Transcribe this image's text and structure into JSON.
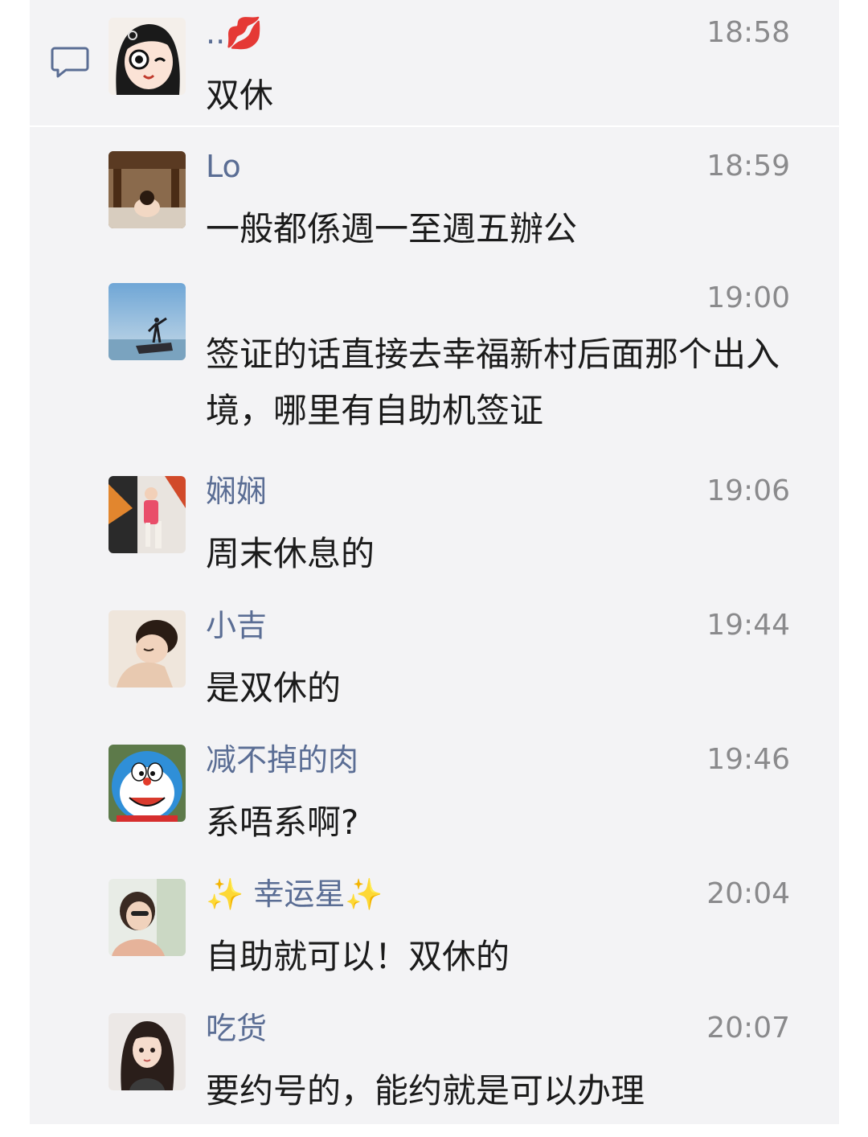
{
  "messages": [
    {
      "name": "..💋",
      "time": "18:58",
      "text": "双休",
      "avatar": "cartoon-girl-avatar"
    },
    {
      "name": "Lo",
      "time": "18:59",
      "text": "一般都係週一至週五辦公",
      "avatar": "toddler-under-table-avatar"
    },
    {
      "name": "",
      "time": "19:00",
      "text": "签证的话直接去幸福新村后面那个出入境，哪里有自助机签证",
      "avatar": "silhouette-on-rock-avatar"
    },
    {
      "name": "娴娴",
      "time": "19:06",
      "text": "周末休息的",
      "avatar": "little-girl-graffiti-avatar"
    },
    {
      "name": "小吉",
      "time": "19:44",
      "text": "是双休的",
      "avatar": "sleeping-child-avatar"
    },
    {
      "name": "减不掉的肉",
      "time": "19:46",
      "text": "系唔系啊?",
      "avatar": "doraemon-avatar"
    },
    {
      "name": "✨ 幸运星✨",
      "time": "20:04",
      "text": "自助就可以！双休的",
      "avatar": "woman-selfie-avatar"
    },
    {
      "name": "吃货",
      "time": "20:07",
      "text": "要约号的，能约就是可以办理",
      "avatar": "illustrated-woman-avatar"
    }
  ],
  "icons": {
    "comment": "comment-bubble-icon"
  },
  "colors": {
    "name": "#5a6d94",
    "time": "#8a8a8c",
    "text": "#1b1b1b",
    "panel": "#f3f3f5"
  }
}
